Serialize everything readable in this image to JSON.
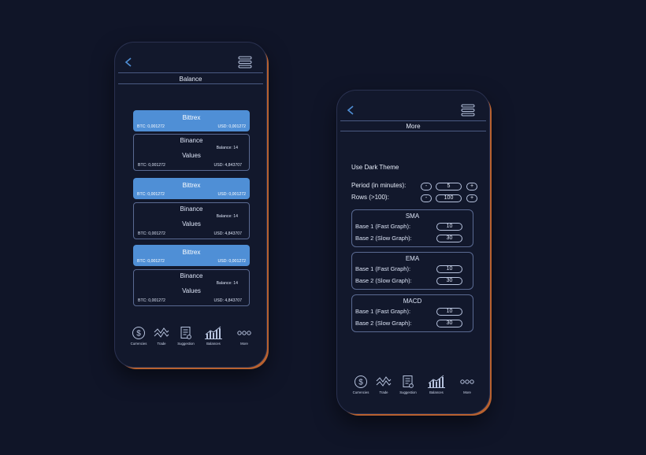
{
  "balance_screen": {
    "title": "Balance",
    "exchanges": [
      {
        "header_name": "Bittrex",
        "header_btc": "BTC: 0,001272",
        "header_usd": "USD: 0,001272",
        "body_name": "Binance",
        "body_values": "Values",
        "body_balance": "Balance:  14",
        "body_btc": "BTC: 0,001272",
        "body_usd": "USD: 4,843707"
      },
      {
        "header_name": "Bittrex",
        "header_btc": "BTC: 0,001272",
        "header_usd": "USD: 0,001272",
        "body_name": "Binance",
        "body_values": "Values",
        "body_balance": "Balance:  14",
        "body_btc": "BTC: 0,001272",
        "body_usd": "USD: 4,843707"
      },
      {
        "header_name": "Bittrex",
        "header_btc": "BTC: 0,001272",
        "header_usd": "USD: 0,001272",
        "body_name": "Binance",
        "body_values": "Values",
        "body_balance": "Balance:  14",
        "body_btc": "BTC: 0,001272",
        "body_usd": "USD: 4,843707"
      }
    ]
  },
  "more_screen": {
    "title": "More",
    "dark_theme_label": "Use Dark Theme",
    "period": {
      "label": "Period (in minutes):",
      "value": "5",
      "minus": "-",
      "plus": "+"
    },
    "rows": {
      "label": "Rows (>100):",
      "value": "100",
      "minus": "-",
      "plus": "+"
    },
    "indicators": [
      {
        "title": "SMA",
        "base1_label": "Base 1 (Fast Graph):",
        "base1_value": "10",
        "base2_label": "Base 2 (Slow Graph):",
        "base2_value": "30"
      },
      {
        "title": "EMA",
        "base1_label": "Base 1 (Fast Graph):",
        "base1_value": "10",
        "base2_label": "Base 2 (Slow Graph):",
        "base2_value": "30"
      },
      {
        "title": "MACD",
        "base1_label": "Base 1 (Fast Graph):",
        "base1_value": "10",
        "base2_label": "Base 2 (Slow Graph):",
        "base2_value": "30"
      }
    ]
  },
  "nav": {
    "currencies": "Currencies",
    "trade": "Trade",
    "suggestion": "Suggestion",
    "balances": "Balances",
    "more": "More"
  },
  "icons": {
    "back": "back-arrow-icon",
    "menu": "hamburger-menu-icon",
    "currencies": "dollar-coin-icon",
    "trade": "zigzag-chart-icon",
    "suggestion": "document-icon",
    "balances": "bar-chart-icon",
    "more": "three-dots-icon"
  },
  "colors": {
    "background": "#101528",
    "phone": "#12182c",
    "accent": "#4f8fd6",
    "frame_edge": "#b8612f"
  }
}
